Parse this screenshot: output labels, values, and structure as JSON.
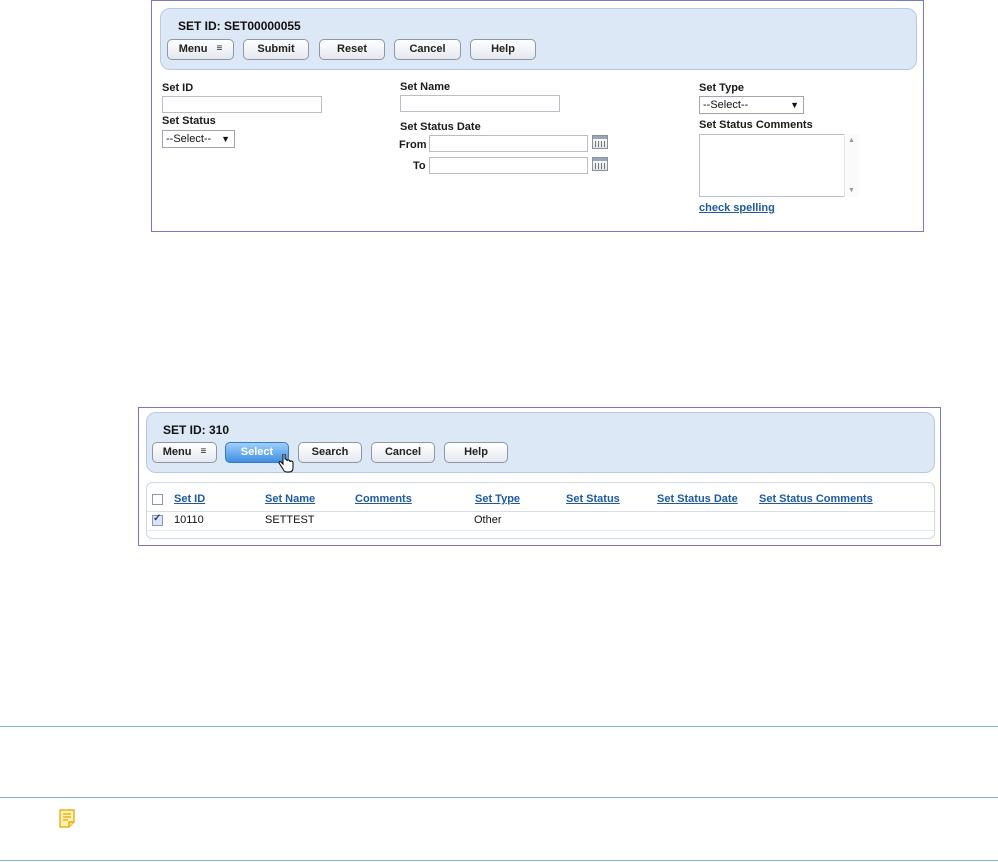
{
  "search_form": {
    "title": "SET ID: SET00000055",
    "buttons": {
      "menu": "Menu",
      "submit": "Submit",
      "reset": "Reset",
      "cancel": "Cancel",
      "help": "Help"
    },
    "fields": {
      "set_id": {
        "label": "Set ID",
        "value": ""
      },
      "set_status": {
        "label": "Set Status",
        "selected": "--Select--"
      },
      "set_name": {
        "label": "Set Name",
        "value": ""
      },
      "set_status_date": {
        "label": "Set Status Date",
        "from_label": "From",
        "to_label": "To",
        "from_value": "",
        "to_value": ""
      },
      "set_type": {
        "label": "Set Type",
        "selected": "--Select--"
      },
      "set_status_comments": {
        "label": "Set Status Comments",
        "value": ""
      }
    },
    "check_spelling": "check spelling"
  },
  "results_panel": {
    "title": "SET ID: 310",
    "buttons": {
      "menu": "Menu",
      "select": "Select",
      "search": "Search",
      "cancel": "Cancel",
      "help": "Help"
    },
    "columns": [
      "Set ID",
      "Set Name",
      "Comments",
      "Set Type",
      "Set Status",
      "Set Status Date",
      "Set Status Comments"
    ],
    "rows": [
      {
        "checked": true,
        "set_id": "10110",
        "set_name": "SETTEST",
        "comments": "",
        "set_type": "Other",
        "set_status": "",
        "set_status_date": "",
        "set_status_comments": ""
      }
    ]
  },
  "icons": {
    "menu_caret": "double-chevron-down-icon",
    "calendar": "calendar-icon",
    "note": "note-icon",
    "cursor": "hand-pointer-icon"
  },
  "colors": {
    "panel_border": "#7b78c8",
    "header_bg": "#dde8f6",
    "link": "#1d5aa0",
    "primary_button": "#3f8ee3",
    "rule": "#7fb6d4"
  }
}
